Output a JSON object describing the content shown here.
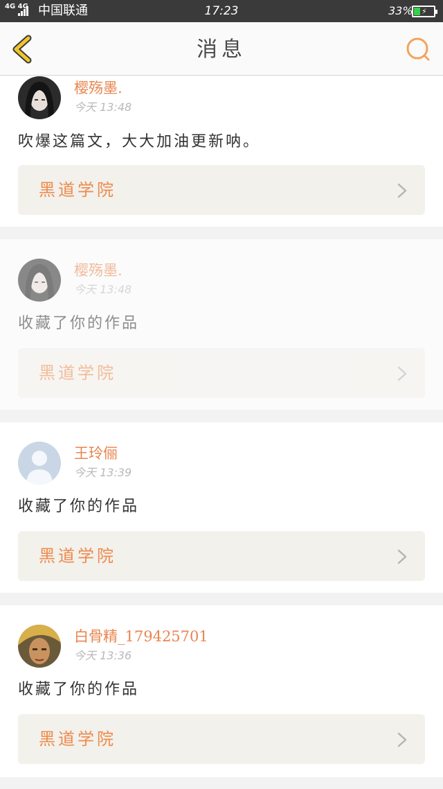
{
  "status_bar": {
    "network": "4G 4G",
    "carrier": "中国联通",
    "time": "17:23",
    "battery_percent": "33%",
    "battery_level": 0.33,
    "charging_symbol": "⚡"
  },
  "nav": {
    "title": "消息",
    "back_icon": "chevron-left-icon",
    "search_icon": "search-icon",
    "accent_color": "#f5a25d"
  },
  "messages": [
    {
      "username": "樱殇墨.",
      "time": "今天 13:48",
      "text": "吹爆这篇文，大大加油更新呐。",
      "work_title": "黑道学院",
      "avatar": "anime-girl-avatar",
      "faded": false
    },
    {
      "username": "樱殇墨.",
      "time": "今天 13:48",
      "text": "收藏了你的作品",
      "work_title": "黑道学院",
      "avatar": "anime-girl-avatar",
      "faded": true
    },
    {
      "username": "王玲俪",
      "time": "今天 13:39",
      "text": "收藏了你的作品",
      "work_title": "黑道学院",
      "avatar": "default-user-avatar",
      "faded": false
    },
    {
      "username": "白骨精_179425701",
      "time": "今天 13:36",
      "text": "收藏了你的作品",
      "work_title": "黑道学院",
      "avatar": "warrior-avatar",
      "faded": false
    }
  ],
  "colors": {
    "username": "#e8854f",
    "work_title": "#ee8a4c",
    "link_bg": "#f2f1ec",
    "back_icon": "#f1c52c",
    "page_bg": "#f2f2f2"
  }
}
